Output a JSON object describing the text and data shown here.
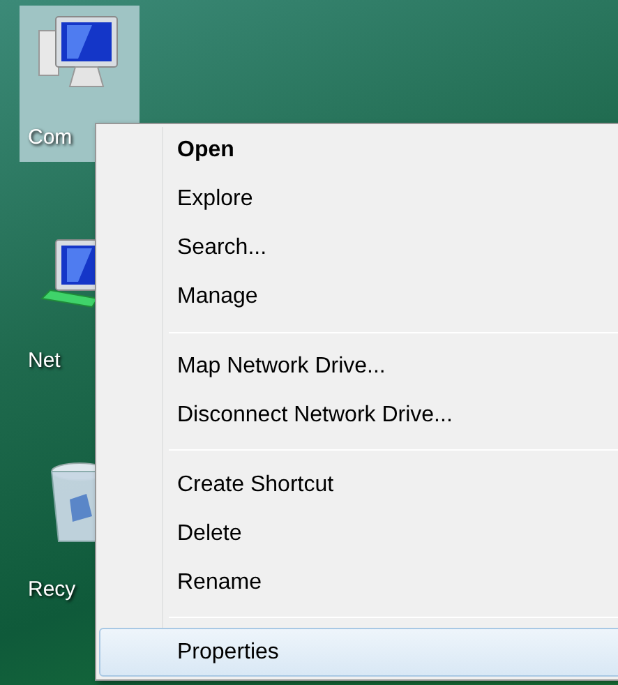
{
  "desktop_icons": [
    {
      "kind": "computer",
      "label": "Com",
      "selected": true
    },
    {
      "kind": "network",
      "label": "Net",
      "selected": false
    },
    {
      "kind": "recycle",
      "label": "Recy",
      "selected": false
    }
  ],
  "context_menu": {
    "items": [
      {
        "kind": "item",
        "label": "Open",
        "default": true,
        "selected": false
      },
      {
        "kind": "item",
        "label": "Explore",
        "default": false,
        "selected": false
      },
      {
        "kind": "item",
        "label": "Search...",
        "default": false,
        "selected": false
      },
      {
        "kind": "item",
        "label": "Manage",
        "default": false,
        "selected": false
      },
      {
        "kind": "separator"
      },
      {
        "kind": "item",
        "label": "Map Network Drive...",
        "default": false,
        "selected": false
      },
      {
        "kind": "item",
        "label": "Disconnect Network Drive...",
        "default": false,
        "selected": false
      },
      {
        "kind": "separator"
      },
      {
        "kind": "item",
        "label": "Create Shortcut",
        "default": false,
        "selected": false
      },
      {
        "kind": "item",
        "label": "Delete",
        "default": false,
        "selected": false
      },
      {
        "kind": "item",
        "label": "Rename",
        "default": false,
        "selected": false
      },
      {
        "kind": "separator"
      },
      {
        "kind": "item",
        "label": "Properties",
        "default": false,
        "selected": true
      }
    ]
  }
}
